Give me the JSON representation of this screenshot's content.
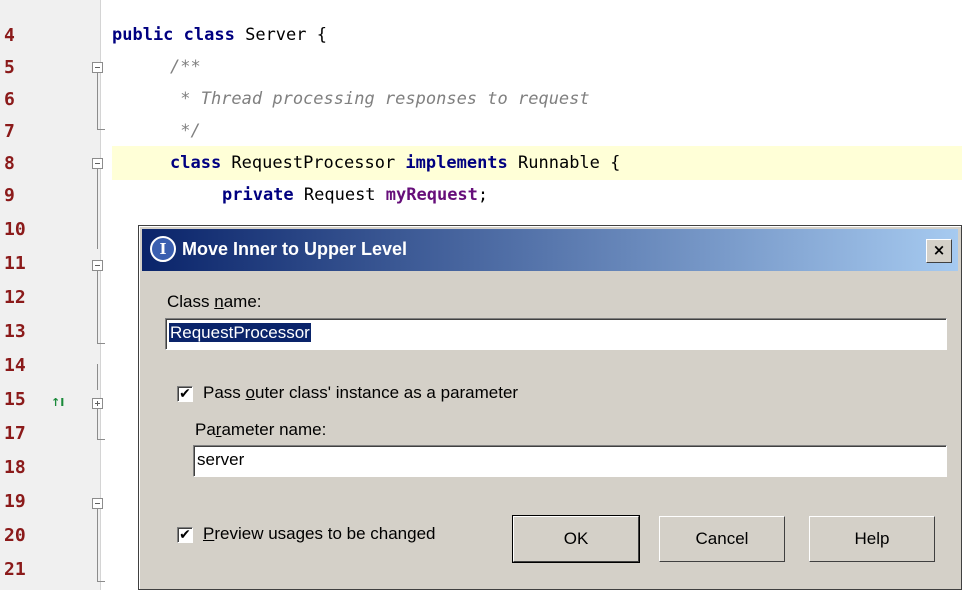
{
  "editor": {
    "line_numbers": [
      "4",
      "5",
      "6",
      "7",
      "8",
      "9",
      "10",
      "11",
      "12",
      "13",
      "14",
      "15",
      "17",
      "18",
      "19",
      "20",
      "21"
    ],
    "code": {
      "line4": {
        "kw1": "public",
        "kw2": "class",
        "rest": " Server {"
      },
      "line5": {
        "comment": "/**"
      },
      "line6": {
        "comment": " * Thread processing responses to request"
      },
      "line7": {
        "comment": " */"
      },
      "line8": {
        "kw1": "class",
        "mid": " RequestProcessor ",
        "kw2": "implements",
        "rest": " Runnable {"
      },
      "line9": {
        "kw1": "private",
        "mid": " Request ",
        "field": "myRequest",
        "rest": ";"
      }
    },
    "implementation_marker": "↑I"
  },
  "dialog": {
    "title": "Move Inner to Upper Level",
    "close_symbol": "×",
    "class_name_label_pre": "Class ",
    "class_name_label_mnemonic": "n",
    "class_name_label_post": "ame:",
    "class_name_value": "RequestProcessor",
    "pass_outer_label_pre": "Pass ",
    "pass_outer_label_mnemonic": "o",
    "pass_outer_label_post": "uter class' instance as a parameter",
    "pass_outer_checked": "✔",
    "param_name_label_pre": "Pa",
    "param_name_label_mnemonic": "r",
    "param_name_label_post": "ameter name:",
    "param_name_value": "server",
    "preview_label_pre": "",
    "preview_label_mnemonic": "P",
    "preview_label_post": "review usages to be changed",
    "preview_checked": "✔",
    "ok_label": "OK",
    "cancel_label": "Cancel",
    "help_label": "Help"
  }
}
